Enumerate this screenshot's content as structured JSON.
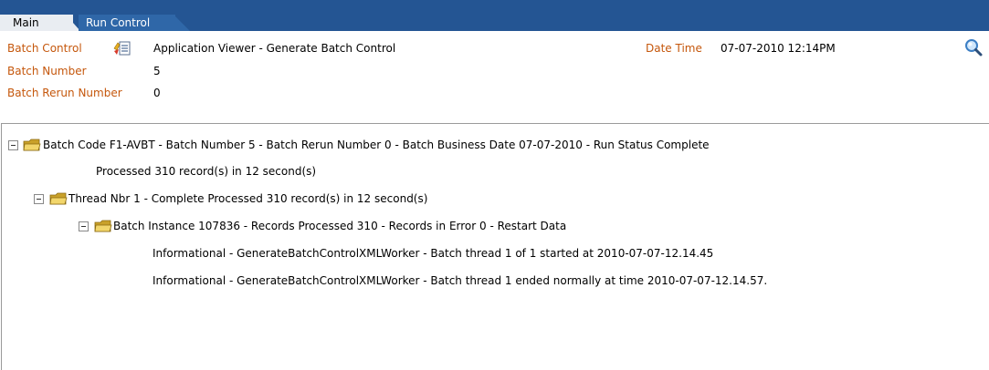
{
  "tabs": [
    {
      "label": "Main"
    },
    {
      "label": "Run Control"
    }
  ],
  "header": {
    "batch_control_label": "Batch Control",
    "batch_control_value": "Application Viewer - Generate Batch Control",
    "datetime_label": "Date Time",
    "datetime_value": "07-07-2010 12:14PM",
    "batch_number_label": "Batch Number",
    "batch_number_value": "5",
    "rerun_label": "Batch Rerun Number",
    "rerun_value": "0"
  },
  "tree": {
    "root": "Batch Code F1-AVBT - Batch Number 5 - Batch Rerun Number 0 - Batch Business Date 07-07-2010 - Run Status Complete",
    "root_detail": "Processed 310 record(s) in 12 second(s)",
    "thread": "Thread Nbr 1 - Complete Processed 310 record(s) in 12 second(s)",
    "instance": "Batch Instance 107836 - Records Processed 310 - Records in Error 0 - Restart Data",
    "messages": [
      "Informational - GenerateBatchControlXMLWorker - Batch thread 1 of 1 started at 2010-07-07-12.14.45",
      "Informational - GenerateBatchControlXMLWorker - Batch thread 1 ended normally at time 2010-07-07-12.14.57."
    ]
  },
  "colors": {
    "tab_bar": "#245593",
    "label": "#c5570c"
  },
  "icons": {
    "batch_control": "batch-control-icon",
    "search": "search-icon",
    "folder": "folder-icon",
    "collapse": "collapse-icon"
  }
}
